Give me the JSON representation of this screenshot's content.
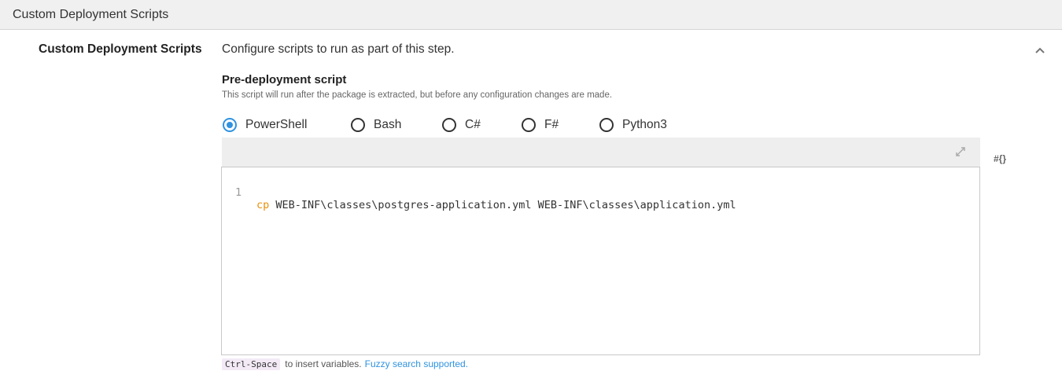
{
  "section": {
    "title": "Custom Deployment Scripts"
  },
  "row": {
    "label": "Custom Deployment Scripts",
    "description": "Configure scripts to run as part of this step.",
    "collapse_icon": "chevron-up-icon"
  },
  "pre_deployment": {
    "title": "Pre-deployment script",
    "hint": "This script will run after the package is extracted, but before any configuration changes are made.",
    "syntax_options": [
      "PowerShell",
      "Bash",
      "C#",
      "F#",
      "Python3"
    ],
    "selected_syntax": "PowerShell",
    "accent_color": "#2f93e0"
  },
  "editor": {
    "toolbar_icons": [
      "expand-icon"
    ],
    "variable_button": "#{}",
    "line_number": "1",
    "code_keyword": "cp",
    "code_rest": " WEB-INF\\classes\\postgres-application.yml WEB-INF\\classes\\application.yml",
    "keyword_color": "#e8900c"
  },
  "footer": {
    "shortcut": "Ctrl-Space",
    "text": "to insert variables.",
    "link": "Fuzzy search supported."
  }
}
